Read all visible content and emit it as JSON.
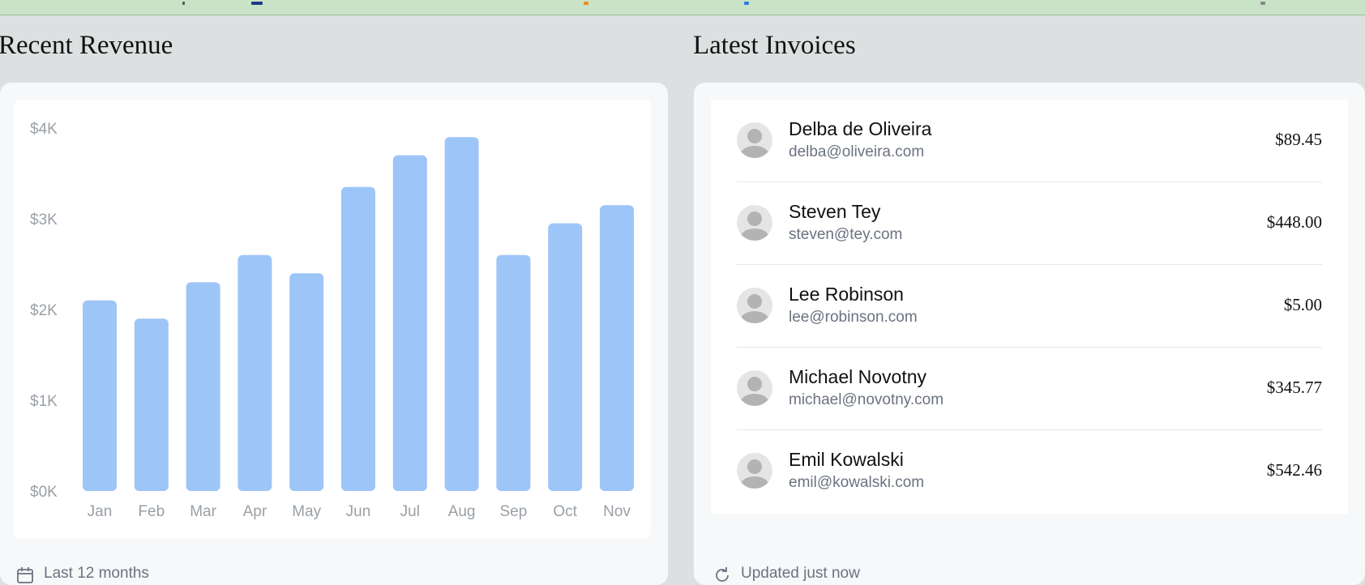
{
  "revenue": {
    "title": "Recent Revenue",
    "footer_text": "Last 12 months",
    "footer_icon": "calendar-icon"
  },
  "invoices": {
    "title": "Latest Invoices",
    "footer_text": "Updated just now",
    "footer_icon": "refresh-icon",
    "rows": [
      {
        "name": "Delba de Oliveira",
        "email": "delba@oliveira.com",
        "amount": "$89.45",
        "avatar_icon": "user-avatar-icon"
      },
      {
        "name": "Steven Tey",
        "email": "steven@tey.com",
        "amount": "$448.00",
        "avatar_icon": "user-avatar-icon"
      },
      {
        "name": "Lee Robinson",
        "email": "lee@robinson.com",
        "amount": "$5.00",
        "avatar_icon": "user-avatar-icon"
      },
      {
        "name": "Michael Novotny",
        "email": "michael@novotny.com",
        "amount": "$345.77",
        "avatar_icon": "user-avatar-icon"
      },
      {
        "name": "Emil Kowalski",
        "email": "emil@kowalski.com",
        "amount": "$542.46",
        "avatar_icon": "user-avatar-icon"
      }
    ]
  },
  "colors": {
    "bar": "#9ec5f8",
    "background": "#dde0e1",
    "panel": "#f7f8f9",
    "topbar": "#c9e3c6"
  },
  "chart_data": {
    "type": "bar",
    "categories": [
      "Jan",
      "Feb",
      "Mar",
      "Apr",
      "May",
      "Jun",
      "Jul",
      "Aug",
      "Sep",
      "Oct",
      "Nov"
    ],
    "values": [
      2100,
      1900,
      2300,
      2600,
      2400,
      3350,
      3700,
      3900,
      2600,
      2950,
      3150
    ],
    "ytick_labels": [
      "$0K",
      "$1K",
      "$2K",
      "$3K",
      "$4K"
    ],
    "ytick_values": [
      0,
      1000,
      2000,
      3000,
      4000
    ],
    "ylim": [
      0,
      4000
    ],
    "grid": false,
    "title": "",
    "xlabel": "",
    "ylabel": ""
  }
}
